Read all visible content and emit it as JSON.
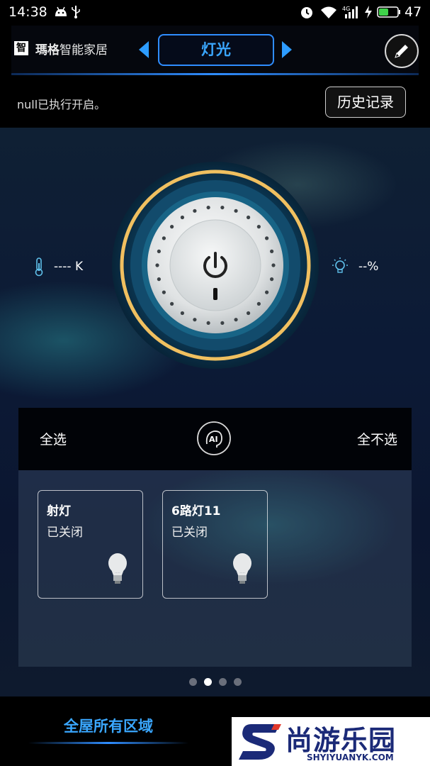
{
  "status_bar": {
    "time": "14:38",
    "battery": "47",
    "network": "4G"
  },
  "header": {
    "logo_glyph": "智",
    "brand_bold": "瑪格",
    "brand_rest": "智能家居",
    "current_tab": "灯光"
  },
  "notice": {
    "message": "null已执行开启。",
    "history_button": "历史记录"
  },
  "controls": {
    "color_temp": "---- K",
    "brightness": "--%"
  },
  "selection": {
    "select_all": "全选",
    "select_none": "全不选",
    "ai_label": "AI"
  },
  "devices": [
    {
      "name": "射灯",
      "status": "已关闭"
    },
    {
      "name": "6路灯11",
      "status": "已关闭"
    }
  ],
  "pager": {
    "pages": 4,
    "active_index": 1
  },
  "bottom": {
    "area_tab": "全屋所有区域"
  },
  "watermark": {
    "cn": "尚游乐园",
    "en": "SHYIYUANYK.COM"
  },
  "colors": {
    "accent": "#2f8dff",
    "ring": "#f0c060",
    "background": "#0c1a36"
  }
}
